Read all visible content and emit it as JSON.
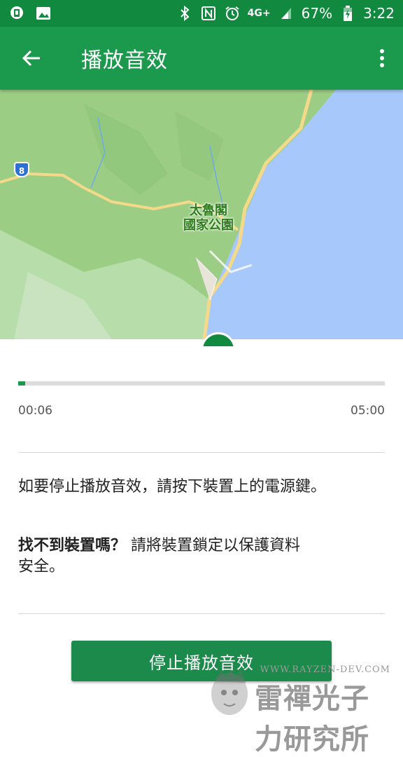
{
  "status_bar": {
    "network": "4G+",
    "battery": "67%",
    "time": "3:22"
  },
  "app_bar": {
    "title": "播放音效"
  },
  "map": {
    "park_label_line1": "太魯閣",
    "park_label_line2": "國家公園",
    "road_shield": "8",
    "colors": {
      "sea": "#a6c8fb",
      "land": "#a8d48f"
    }
  },
  "playback": {
    "elapsed": "00:06",
    "total": "05:00",
    "progress": 0.02
  },
  "instructions": "如要停止播放音效，請按下裝置上的電源鍵。",
  "lost_device": {
    "bold_part": "找不到裝置嗎？",
    "normal_part": "請將裝置鎖定以保護資料安全。"
  },
  "stop_button": {
    "label": "停止播放音效"
  },
  "watermark": {
    "url": "WWW.RAYZEN-DEV.COM",
    "text": "雷禪光子力研究所"
  },
  "colors": {
    "status_bar": "#11893f",
    "app_bar": "#1b9a4d",
    "accent": "#1b8a4a"
  }
}
